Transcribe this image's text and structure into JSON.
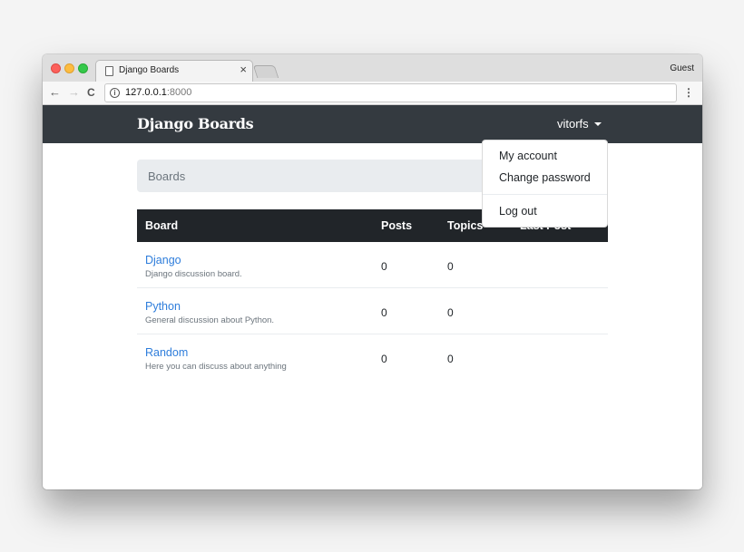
{
  "browser": {
    "tab_title": "Django Boards",
    "tab_close": "×",
    "profile": "Guest",
    "url_host": "127.0.0.1",
    "url_port": ":8000",
    "back_icon": "←",
    "forward_icon": "→",
    "reload_icon": "C",
    "info_icon": "i",
    "menu_icon": "⋮"
  },
  "app": {
    "brand": "Django Boards",
    "username": "vitorfs",
    "breadcrumb": "Boards",
    "dropdown": {
      "my_account": "My account",
      "change_password": "Change password",
      "log_out": "Log out"
    }
  },
  "table": {
    "headers": {
      "board": "Board",
      "posts": "Posts",
      "topics": "Topics",
      "last_post": "Last Post"
    },
    "rows": [
      {
        "name": "Django",
        "description": "Django discussion board.",
        "posts": "0",
        "topics": "0"
      },
      {
        "name": "Python",
        "description": "General discussion about Python.",
        "posts": "0",
        "topics": "0"
      },
      {
        "name": "Random",
        "description": "Here you can discuss about anything",
        "posts": "0",
        "topics": "0"
      }
    ]
  },
  "colors": {
    "navbar": "#343a40",
    "table_header": "#212529",
    "link": "#2e7ddb",
    "breadcrumb_bg": "#e9ecef"
  }
}
